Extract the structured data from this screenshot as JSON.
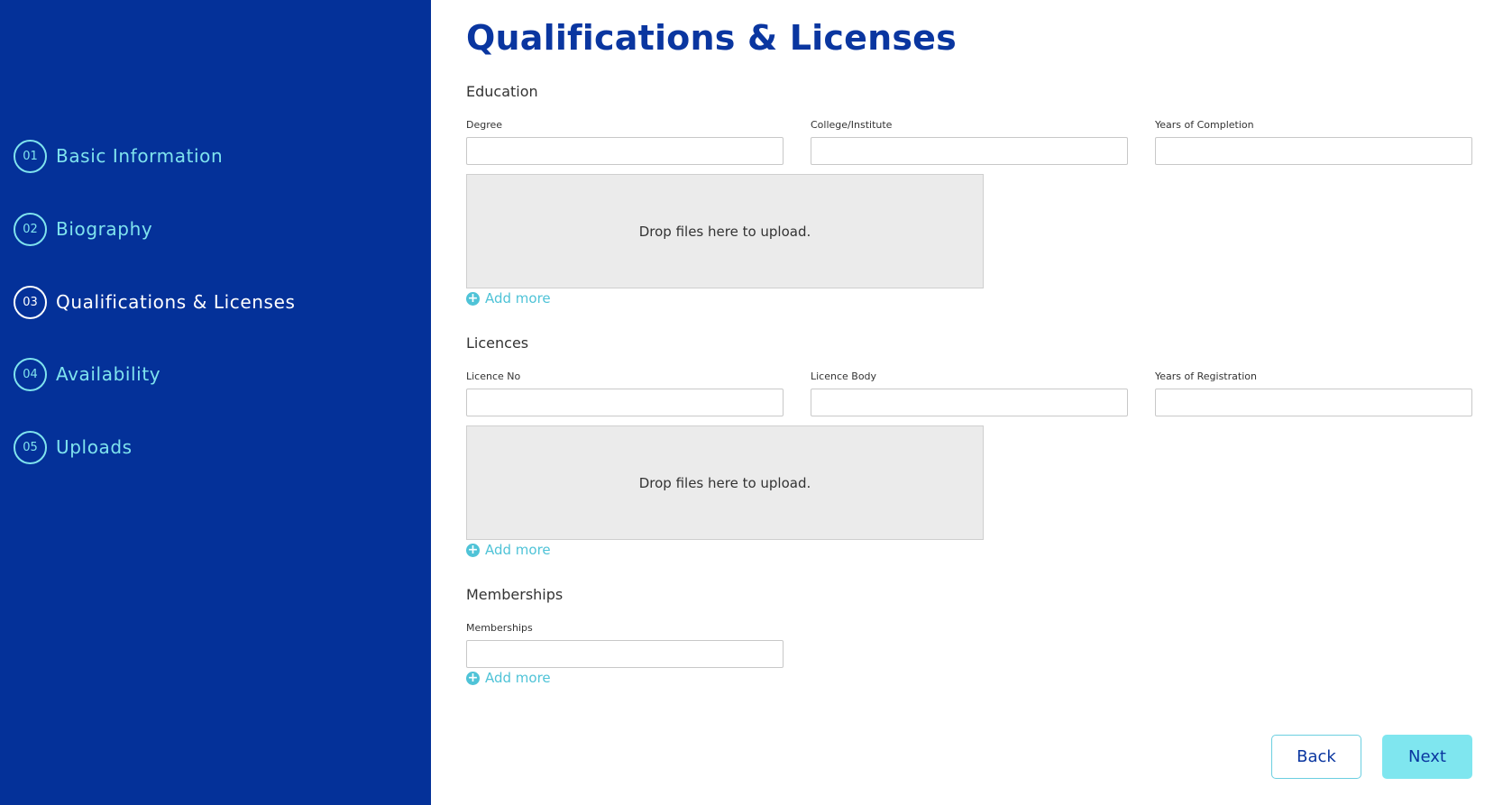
{
  "sidebar": {
    "steps": [
      {
        "num": "01",
        "label": "Basic Information"
      },
      {
        "num": "02",
        "label": "Biography"
      },
      {
        "num": "03",
        "label": "Qualifications & Licenses"
      },
      {
        "num": "04",
        "label": "Availability"
      },
      {
        "num": "05",
        "label": "Uploads"
      }
    ],
    "active_step": "03"
  },
  "page": {
    "title": "Qualifications & Licenses"
  },
  "education": {
    "title": "Education",
    "degree_label": "Degree",
    "degree_value": "",
    "college_label": "College/Institute",
    "college_value": "",
    "years_label": "Years of Completion",
    "years_value": "",
    "dropzone_text": "Drop files here to upload.",
    "add_more": "Add more"
  },
  "licences": {
    "title": "Licences",
    "licence_no_label": "Licence No",
    "licence_no_value": "",
    "licence_body_label": "Licence Body",
    "licence_body_value": "",
    "years_label": "Years of Registration",
    "years_value": "",
    "dropzone_text": "Drop files here to upload.",
    "add_more": "Add more"
  },
  "memberships": {
    "title": "Memberships",
    "field_label": "Memberships",
    "field_value": "",
    "add_more": "Add more"
  },
  "actions": {
    "back_label": "Back",
    "next_label": "Next"
  },
  "colors": {
    "sidebar_bg": "#043199",
    "accent": "#7fe3ee",
    "title": "#0a36a0",
    "link": "#4fc3d7"
  }
}
